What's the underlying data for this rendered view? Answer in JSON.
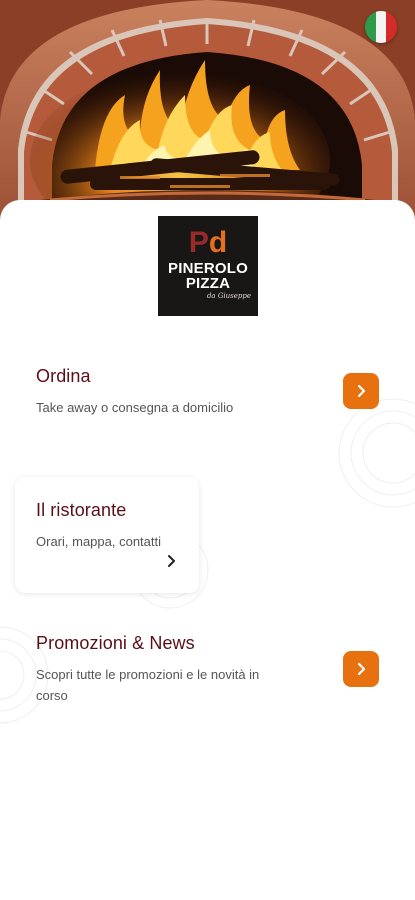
{
  "header": {
    "hero_image": "pizza-oven-fire-photo",
    "language_flag": "italian-flag-icon"
  },
  "logo": {
    "mark": [
      "P",
      "d"
    ],
    "line1": "PINEROLO",
    "line2": "PIZZA",
    "tagline": "da Giuseppe"
  },
  "menu": {
    "ordina": {
      "title": "Ordina",
      "subtitle": "Take away o consegna a domicilio",
      "icon": "chevron-right-icon"
    },
    "ristorante": {
      "title": "Il ristorante",
      "subtitle": "Orari, mappa, contatti",
      "icon": "chevron-right-icon"
    },
    "promozioni": {
      "title": "Promozioni & News",
      "subtitle_line1": "Scopri tutte le promozioni e le novità in",
      "subtitle_line2": "corso",
      "icon": "chevron-right-icon"
    }
  },
  "colors": {
    "accent": "#e8710f",
    "title": "#5a0f16",
    "text": "#555555"
  }
}
